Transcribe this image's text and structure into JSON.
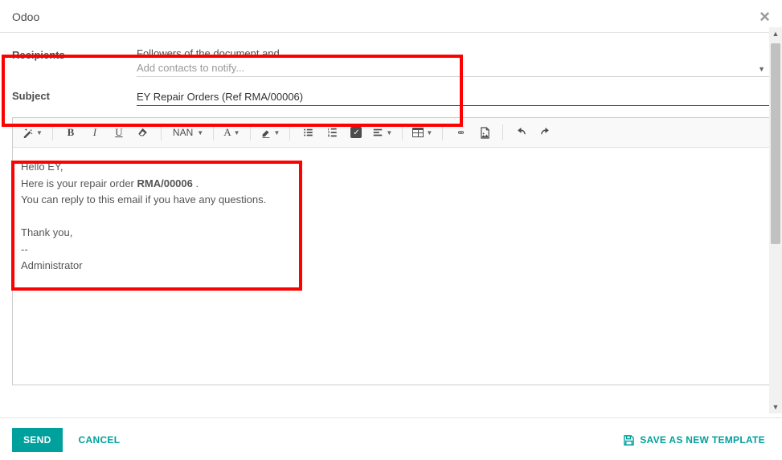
{
  "modal": {
    "title": "Odoo",
    "close": "×"
  },
  "form": {
    "recipients_label": "Recipients",
    "followers_text": "Followers of the document and",
    "contacts_placeholder": "Add contacts to notify...",
    "subject_label": "Subject",
    "subject_value": "EY Repair Orders (Ref RMA/00006)"
  },
  "toolbar": {
    "font_name": "NAN"
  },
  "editor": {
    "greeting": "Hello EY,",
    "line_prefix": "Here is your repair order ",
    "order_ref": "RMA/00006",
    "line_suffix": " .",
    "reply_line": "You can reply to this email if you have any questions.",
    "thanks": "Thank you,",
    "sig_dash": "--",
    "sig_name": "Administrator"
  },
  "footer": {
    "send": "SEND",
    "cancel": "CANCEL",
    "save_template": "SAVE AS NEW TEMPLATE"
  }
}
